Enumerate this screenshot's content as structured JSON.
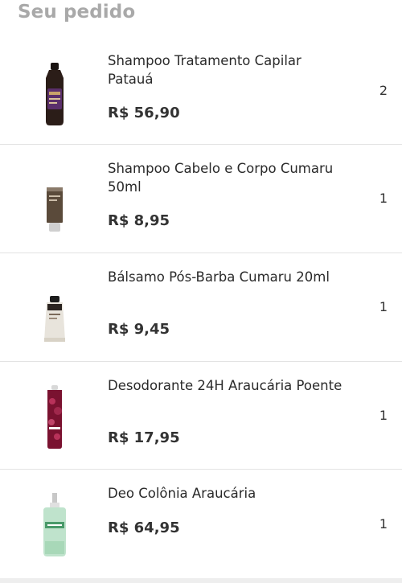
{
  "header": {
    "title": "Seu pedido"
  },
  "items": [
    {
      "name": "Shampoo Tratamento Capilar Patauá",
      "price": "R$ 56,90",
      "quantity": "2",
      "icon": "dark-shampoo-bottle-icon"
    },
    {
      "name": "Shampoo Cabelo e Corpo Cumaru 50ml",
      "price": "R$ 8,95",
      "quantity": "1",
      "icon": "brown-tube-icon"
    },
    {
      "name": "Bálsamo Pós-Barba Cumaru 20ml",
      "price": "R$ 9,45",
      "quantity": "1",
      "icon": "aftershave-tube-icon"
    },
    {
      "name": "Desodorante 24H Araucária Poente",
      "price": "R$ 17,95",
      "quantity": "1",
      "icon": "aerosol-can-icon"
    },
    {
      "name": "Deo Colônia Araucária",
      "price": "R$ 64,95",
      "quantity": "1",
      "icon": "cologne-bottle-icon"
    }
  ],
  "colors": {
    "title": "#a9a9a9",
    "divider": "#e3e3e3",
    "text": "#2a2a2a"
  }
}
